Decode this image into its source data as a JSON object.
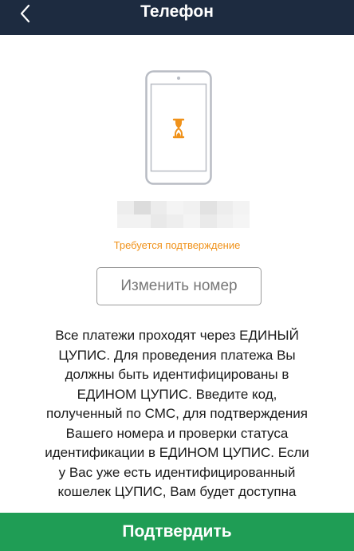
{
  "header": {
    "title": "Телефон",
    "back_icon": "chevron-left-icon",
    "background_color": "#1d2b40"
  },
  "illustration": {
    "icon": "hourglass-icon",
    "phone_outline_color": "#b8bcc4",
    "hourglass_color": "#f0921a"
  },
  "phone_number": {
    "redacted": true
  },
  "status": {
    "text": "Требуется подтверждение",
    "color": "#f0921a"
  },
  "change_number_button": {
    "label": "Изменить номер"
  },
  "info": {
    "text": "Все платежи проходят через ЕДИНЫЙ\nЦУПИС. Для проведения платежа Вы\nдолжны быть идентифицированы в\nЕДИНОМ ЦУПИС. Введите код,\nполученный по СМС, для подтверждения\nВашего номера и проверки статуса\nидентификации в ЕДИНОМ ЦУПИС. Если\nу Вас уже есть идентифицированный\nкошелек ЦУПИС, Вам будет доступна"
  },
  "confirm_button": {
    "label": "Подтвердить",
    "color": "#1f9d55"
  }
}
